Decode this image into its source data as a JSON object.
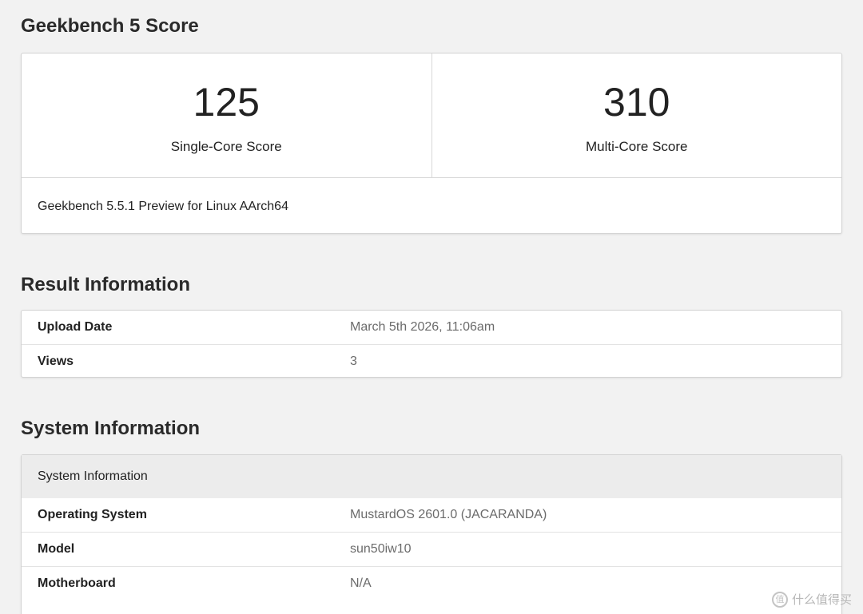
{
  "score_section": {
    "title": "Geekbench 5 Score",
    "single_core": {
      "value": "125",
      "label": "Single-Core Score"
    },
    "multi_core": {
      "value": "310",
      "label": "Multi-Core Score"
    },
    "footer": "Geekbench 5.5.1 Preview for Linux AArch64"
  },
  "result_section": {
    "title": "Result Information",
    "rows": [
      {
        "key": "Upload Date",
        "value": "March 5th 2026, 11:06am"
      },
      {
        "key": "Views",
        "value": "3"
      }
    ]
  },
  "system_section": {
    "title": "System Information",
    "table_header": "System Information",
    "rows": [
      {
        "key": "Operating System",
        "value": "MustardOS 2601.0 (JACARANDA)"
      },
      {
        "key": "Model",
        "value": "sun50iw10"
      },
      {
        "key": "Motherboard",
        "value": "N/A"
      }
    ]
  },
  "watermark": {
    "text": "什么值得买",
    "icon": "值"
  }
}
